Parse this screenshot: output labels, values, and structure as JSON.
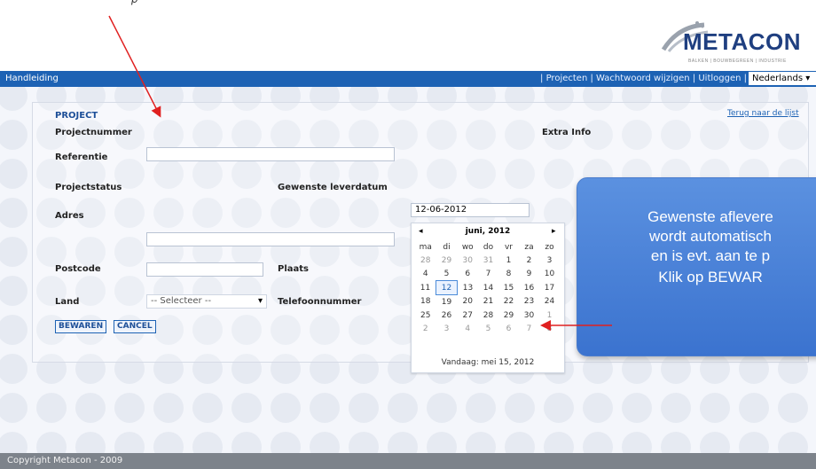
{
  "top": {
    "fragment": "p"
  },
  "brand": {
    "logo_text": "METACON",
    "tagline": "BALKEN | BOUWBEGREEN | INDUSTRIE"
  },
  "nav": {
    "left_link": "Handleiding",
    "right_links": "| Projecten | Wachtwoord wijzigen | Uitloggen |",
    "language": "Nederlands"
  },
  "form": {
    "section_title": "PROJECT",
    "back_link": "Terug naar de lijst",
    "labels": {
      "projectnummer": "Projectnummer",
      "referentie": "Referentie",
      "projectstatus": "Projectstatus",
      "gewenste_leverdatum": "Gewenste leverdatum",
      "adres": "Adres",
      "postcode": "Postcode",
      "plaats": "Plaats",
      "land": "Land",
      "telefoonnummer": "Telefoonnummer",
      "extra_info": "Extra Info"
    },
    "values": {
      "leverdatum": "12-06-2012",
      "land_select": "-- Selecteer --"
    },
    "buttons": {
      "save": "BEWAREN",
      "cancel": "CANCEL"
    }
  },
  "calendar": {
    "month_title": "juni, 2012",
    "prev": "◂",
    "next": "▸",
    "weekdays": [
      "ma",
      "di",
      "wo",
      "do",
      "vr",
      "za",
      "zo"
    ],
    "weeks": [
      [
        "28",
        "29",
        "30",
        "31",
        "1",
        "2",
        "3"
      ],
      [
        "4",
        "5",
        "6",
        "7",
        "8",
        "9",
        "10"
      ],
      [
        "11",
        "12",
        "13",
        "14",
        "15",
        "16",
        "17"
      ],
      [
        "18",
        "19",
        "20",
        "21",
        "22",
        "23",
        "24"
      ],
      [
        "25",
        "26",
        "27",
        "28",
        "29",
        "30",
        "1"
      ],
      [
        "2",
        "3",
        "4",
        "5",
        "6",
        "7",
        "8"
      ]
    ],
    "selected": "12",
    "today_label": "Vandaag: mei 15, 2012"
  },
  "callout": {
    "lines": [
      "Gewenste aflevere",
      "wordt automatisch",
      "en is evt. aan te p",
      "Klik op BEWAR"
    ]
  },
  "footer": {
    "copyright": "Copyright Metacon - 2009"
  },
  "colors": {
    "nav": "#1d62b4",
    "callout": "#3b73cf",
    "annotation_arrow": "#e02020"
  }
}
